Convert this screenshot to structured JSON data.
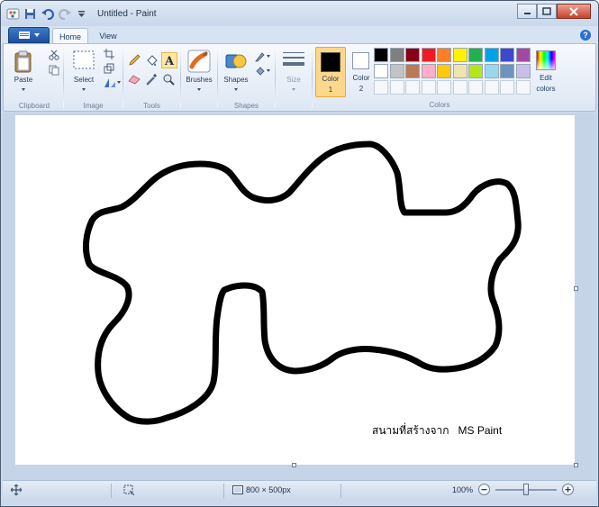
{
  "window": {
    "title": "Untitled - Paint"
  },
  "tabs": [
    {
      "label": "Home",
      "active": true
    },
    {
      "label": "View",
      "active": false
    }
  ],
  "ribbon": {
    "clipboard": {
      "paste_label": "Paste",
      "group_label": "Clipboard"
    },
    "image": {
      "select_label": "Select",
      "group_label": "Image"
    },
    "tools": {
      "group_label": "Tools"
    },
    "brushes": {
      "label": "Brushes"
    },
    "shapes": {
      "label": "Shapes",
      "group_label": "Shapes"
    },
    "size": {
      "label": "Size"
    },
    "colors": {
      "color1_label": "Color",
      "color1_num": "1",
      "color2_label": "Color",
      "color2_num": "2",
      "edit_label1": "Edit",
      "edit_label2": "colors",
      "group_label": "Colors",
      "color1_value": "#000000",
      "color2_value": "#ffffff",
      "palette_row1": [
        "#000000",
        "#7f7f7f",
        "#880015",
        "#ed1c24",
        "#ff7f27",
        "#fff200",
        "#22b14c",
        "#00a2e8",
        "#3f48cc",
        "#a349a4"
      ],
      "palette_row2": [
        "#ffffff",
        "#c3c3c3",
        "#b97a57",
        "#ffaec9",
        "#ffc90e",
        "#efe4b0",
        "#b5e61d",
        "#99d9ea",
        "#7092be",
        "#c8bfe7"
      ]
    }
  },
  "canvas": {
    "annotation": "สนามที่สร้างจาก   MS Paint"
  },
  "status": {
    "dimensions": "800 × 500px",
    "zoom": "100%"
  }
}
